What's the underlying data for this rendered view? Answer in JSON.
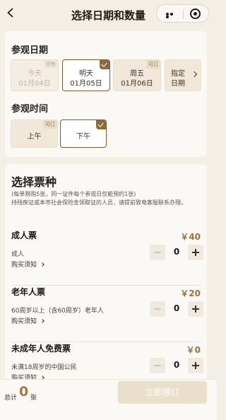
{
  "header": {
    "title": "选择日期和数量",
    "back_icon": "chevron-left-icon",
    "more_icon": "more-dots-icon",
    "close_icon": "target-icon"
  },
  "visit_date": {
    "label": "参观日期",
    "options": [
      {
        "line1": "今天",
        "line2": "01月04日",
        "tag": "停售",
        "state": "disabled"
      },
      {
        "line1": "明天",
        "line2": "01月05日",
        "tag": "",
        "state": "selected"
      },
      {
        "line1": "周五",
        "line2": "01月06日",
        "tag": "可订",
        "state": "available"
      }
    ],
    "more": {
      "line1": "指定",
      "line2": "日期"
    }
  },
  "visit_time": {
    "label": "参观时间",
    "options": [
      {
        "label": "上午",
        "tag": "可订",
        "state": "available"
      },
      {
        "label": "下午",
        "tag": "",
        "state": "selected"
      }
    ]
  },
  "tickets": {
    "heading": "选择票种",
    "notice": "(每单限购5张，同一证件每个参观日仅能预约1张)\n持残疾证或本市社会保险金领取证的人员，请提前致电客服联系办理。",
    "items": [
      {
        "name": "成人票",
        "price": "￥40",
        "desc": "成人",
        "notes": "购买须知",
        "qty": "0"
      },
      {
        "name": "老年人票",
        "price": "￥20",
        "desc": "60周岁以上（含60周岁）老年人",
        "notes": "购买须知",
        "qty": "0"
      },
      {
        "name": "未成年人免费票",
        "price": "￥0",
        "desc": "未满18周岁的中国公民",
        "notes": "购买须知",
        "qty": "0"
      }
    ]
  },
  "footer": {
    "total_label": "总计",
    "total_count": "0",
    "total_unit": "张",
    "book_label": "立即预订"
  },
  "colors": {
    "accent": "#8b6b3d",
    "price": "#9a7440",
    "background": "#f4efe6"
  }
}
